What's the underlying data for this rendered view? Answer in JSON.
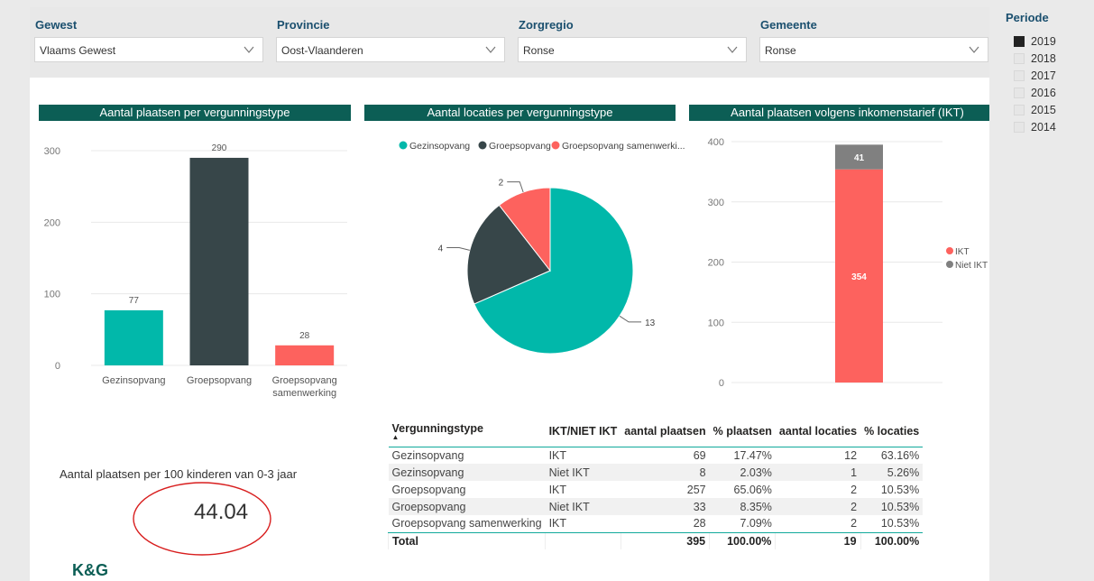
{
  "filters": [
    {
      "title": "Gewest",
      "value": "Vlaams Gewest"
    },
    {
      "title": "Provincie",
      "value": "Oost-Vlaanderen"
    },
    {
      "title": "Zorgregio",
      "value": "Ronse"
    },
    {
      "title": "Gemeente",
      "value": "Ronse"
    }
  ],
  "periode": {
    "title": "Periode",
    "years": [
      "2019",
      "2018",
      "2017",
      "2016",
      "2015",
      "2014"
    ],
    "selected": "2019"
  },
  "chart_data": [
    {
      "type": "bar",
      "title": "Aantal plaatsen per vergunningstype",
      "categories": [
        "Gezinsopvang",
        "Groepsopvang",
        "Groepsopvang samenwerking"
      ],
      "values": [
        77,
        290,
        28
      ],
      "data_labels": [
        "77",
        "290",
        "28"
      ],
      "colors": [
        "#01b8aa",
        "#374649",
        "#fd625e"
      ],
      "yticks": [
        "0",
        "100",
        "200",
        "300"
      ],
      "ylim": [
        0,
        300
      ],
      "grid": true
    },
    {
      "type": "pie",
      "title": "Aantal locaties per vergunningstype",
      "legend": [
        "Gezinsopvang",
        "Groepsopvang",
        "Groepsopvang samenwerki..."
      ],
      "categories": [
        "Gezinsopvang",
        "Groepsopvang",
        "Groepsopvang samenwerking"
      ],
      "values": [
        13,
        4,
        2
      ],
      "data_labels": [
        "13",
        "4",
        "2"
      ],
      "colors": [
        "#01b8aa",
        "#374649",
        "#fd625e"
      ],
      "legend_position": "top"
    },
    {
      "type": "bar",
      "stacked": true,
      "title": "Aantal plaatsen volgens inkomenstarief (IKT)",
      "categories": [
        ""
      ],
      "series": [
        {
          "name": "IKT",
          "values": [
            354
          ],
          "color": "#fd625e"
        },
        {
          "name": "Niet IKT",
          "values": [
            41
          ],
          "color": "#808080"
        }
      ],
      "data_labels": [
        "354",
        "41"
      ],
      "yticks": [
        "0",
        "100",
        "200",
        "300",
        "400"
      ],
      "ylim": [
        0,
        400
      ],
      "legend_position": "right",
      "grid": true
    }
  ],
  "kpi": {
    "label": "Aantal plaatsen per 100 kinderen van 0-3 jaar",
    "value": "44.04"
  },
  "table": {
    "headers": [
      "Vergunningstype",
      "IKT/NIET IKT",
      "aantal plaatsen",
      "% plaatsen",
      "aantal locaties",
      "% locaties"
    ],
    "sort_indicator": "▲",
    "rows": [
      [
        "Gezinsopvang",
        "IKT",
        "69",
        "17.47%",
        "12",
        "63.16%"
      ],
      [
        "Gezinsopvang",
        "Niet IKT",
        "8",
        "2.03%",
        "1",
        "5.26%"
      ],
      [
        "Groepsopvang",
        "IKT",
        "257",
        "65.06%",
        "2",
        "10.53%"
      ],
      [
        "Groepsopvang",
        "Niet IKT",
        "33",
        "8.35%",
        "2",
        "10.53%"
      ],
      [
        "Groepsopvang samenwerking",
        "IKT",
        "28",
        "7.09%",
        "2",
        "10.53%"
      ]
    ],
    "total": [
      "Total",
      "",
      "395",
      "100.00%",
      "19",
      "100.00%"
    ]
  },
  "logo_text": "K&G"
}
